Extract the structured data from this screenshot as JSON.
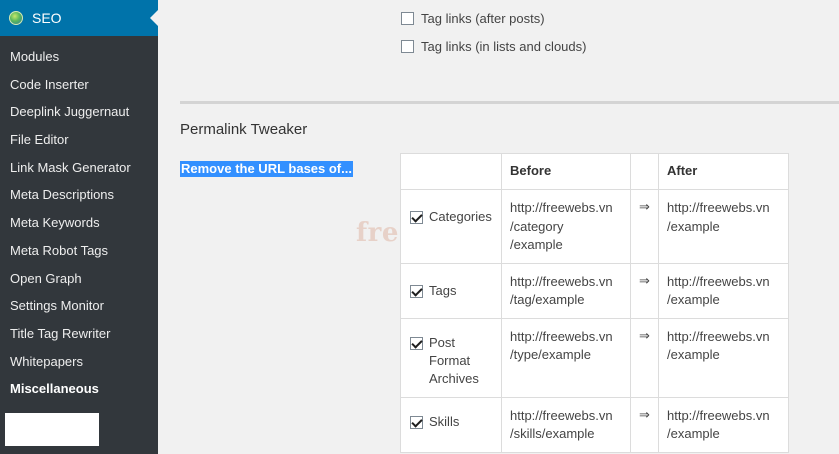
{
  "sidebar": {
    "header_label": "SEO",
    "items": [
      {
        "label": "Modules"
      },
      {
        "label": "Code Inserter"
      },
      {
        "label": "Deeplink Juggernaut"
      },
      {
        "label": "File Editor"
      },
      {
        "label": "Link Mask Generator"
      },
      {
        "label": "Meta Descriptions"
      },
      {
        "label": "Meta Keywords"
      },
      {
        "label": "Meta Robot Tags"
      },
      {
        "label": "Open Graph"
      },
      {
        "label": "Settings Monitor"
      },
      {
        "label": "Title Tag Rewriter"
      },
      {
        "label": "Whitepapers"
      },
      {
        "label": "Miscellaneous"
      }
    ]
  },
  "options": {
    "tag_links_after_posts": "Tag links (after posts)",
    "tag_links_lists_clouds": "Tag links (in lists and clouds)"
  },
  "permalink": {
    "title": "Permalink Tweaker",
    "field_label": "Remove the URL bases of...",
    "headers": {
      "before": "Before",
      "after": "After"
    },
    "arrow": "⇒",
    "rows": [
      {
        "type": "Categories",
        "before": [
          "http://freewebs.vn",
          "/category",
          "/example"
        ],
        "after": [
          "http://freewebs.vn",
          "/example"
        ],
        "checked": true
      },
      {
        "type": "Tags",
        "before": [
          "http://freewebs.vn",
          "/tag/example"
        ],
        "after": [
          "http://freewebs.vn",
          "/example"
        ],
        "checked": true
      },
      {
        "type_lines": [
          "Post",
          "Format",
          "Archives"
        ],
        "before": [
          "http://freewebs.vn",
          "/type/example"
        ],
        "after": [
          "http://freewebs.vn",
          "/example"
        ],
        "checked": true
      },
      {
        "type": "Skills",
        "before": [
          "http://freewebs.vn",
          "/skills/example"
        ],
        "after": [
          "http://freewebs.vn",
          "/example"
        ],
        "checked": true
      }
    ]
  },
  "watermark": "freewebs.vn",
  "colors": {
    "sidebar_bg": "#32373c",
    "active_menu": "#0073aa",
    "selection": "#3390ff"
  }
}
